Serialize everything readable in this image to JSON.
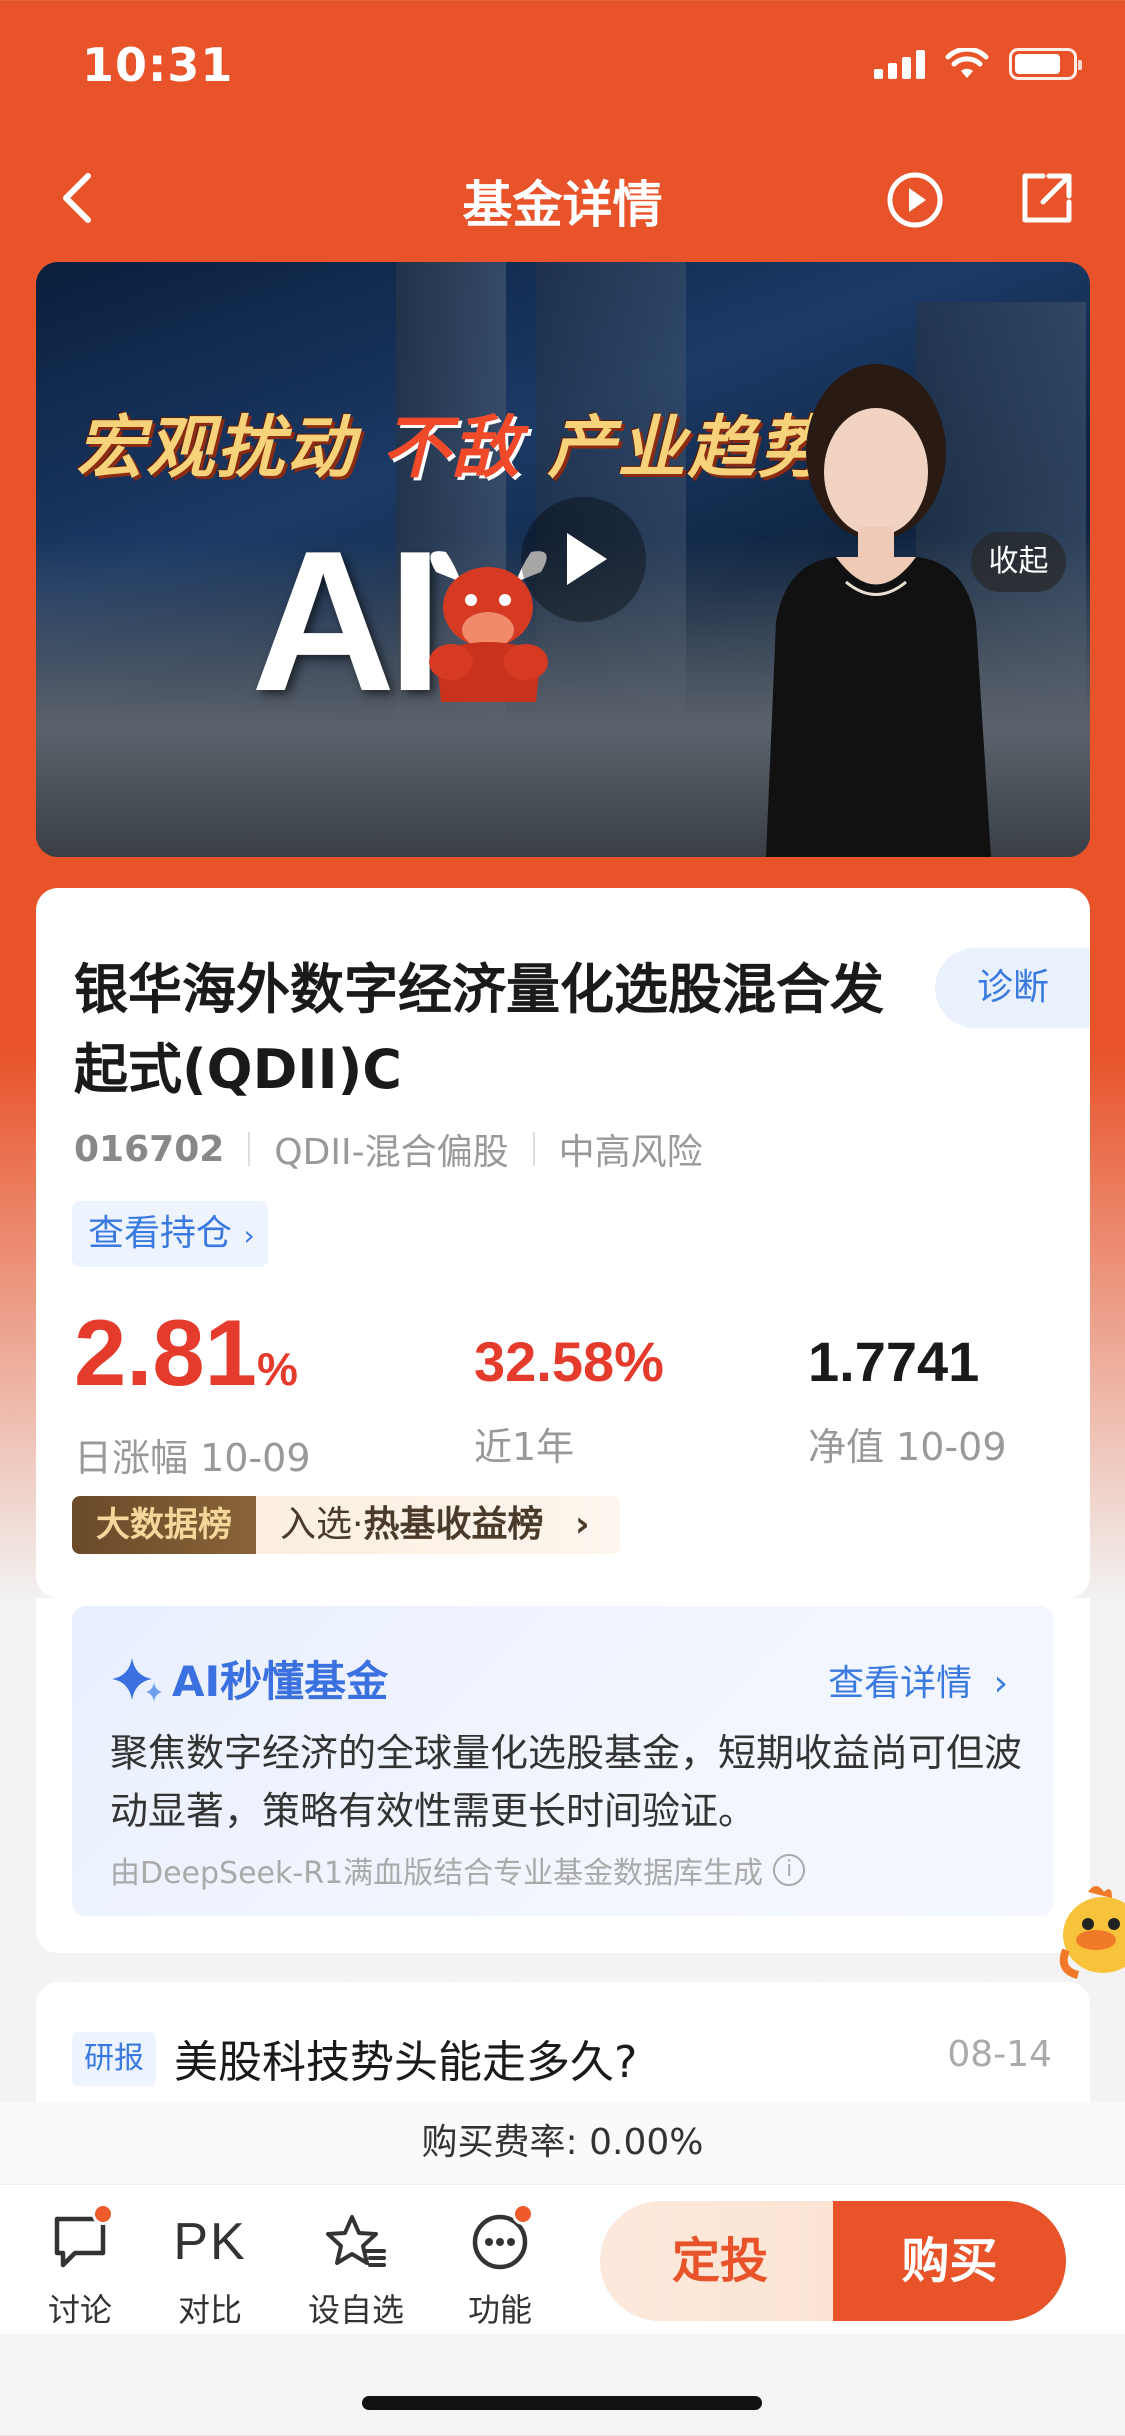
{
  "status_bar": {
    "time": "10:31"
  },
  "nav": {
    "title": "基金详情"
  },
  "banner": {
    "headline_part1": "宏观扰动",
    "headline_part2": "不敌",
    "headline_part3": "产业趋势",
    "ai_text": "AI",
    "collapse_label": "收起"
  },
  "fund": {
    "name": "银华海外数字经济量化选股混合发起式(QDII)C",
    "diagnose_label": "诊断",
    "code": "016702",
    "category": "QDII-混合偏股",
    "risk": "中高风险",
    "holdings_label": "查看持仓",
    "daily_change": {
      "value": "2.81",
      "unit": "%",
      "label": "日涨幅 10-09"
    },
    "one_year": {
      "value": "32.58%",
      "label": "近1年"
    },
    "nav": {
      "value": "1.7741",
      "label": "净值 10-09"
    },
    "bigdata": {
      "badge": "大数据榜",
      "prefix": "入选·",
      "ranking": "热基收益榜"
    },
    "colors": {
      "up": "#e53b2c",
      "accent": "#e8532a",
      "link": "#3a7ae0"
    }
  },
  "ai_summary": {
    "title": "AI秒懂基金",
    "detail_label": "查看详情",
    "body": "聚焦数字经济的全球量化选股基金，短期收益尚可但波动显著，策略有效性需更长时间验证。",
    "source": "由DeepSeek-R1满血版结合专业基金数据库生成"
  },
  "research": {
    "tag": "研报",
    "title": "美股科技势头能走多久?",
    "date": "08-14"
  },
  "fee": {
    "text": "购买费率: 0.00%"
  },
  "bottom_bar": {
    "tools": [
      {
        "label": "讨论",
        "icon": "chat-bubble-icon"
      },
      {
        "label": "对比",
        "icon": "PK"
      },
      {
        "label": "设自选",
        "icon": "star-list-icon"
      },
      {
        "label": "功能",
        "icon": "more-dots-icon"
      }
    ],
    "dingtou_label": "定投",
    "buy_label": "购买"
  }
}
